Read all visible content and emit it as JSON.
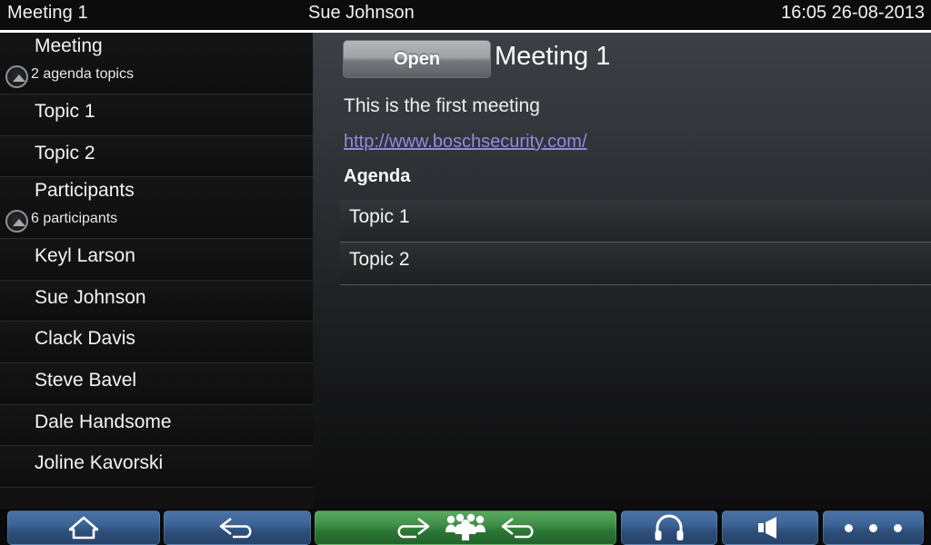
{
  "titlebar": {
    "left": "Meeting 1",
    "center": "Sue Johnson",
    "right": "16:05 26-08-2013"
  },
  "sidebar": {
    "groups": [
      {
        "label": "Meeting",
        "sub": "2 agenda topics",
        "icon": "collapse-up-icon"
      },
      {
        "label": "Topic 1"
      },
      {
        "label": "Topic 2"
      },
      {
        "label": "Participants",
        "sub": "6 participants",
        "icon": "collapse-up-icon"
      },
      {
        "label": "Keyl Larson"
      },
      {
        "label": "Sue Johnson"
      },
      {
        "label": "Clack Davis"
      },
      {
        "label": "Steve Bavel"
      },
      {
        "label": "Dale Handsome"
      },
      {
        "label": "Joline Kavorski"
      }
    ]
  },
  "main": {
    "open_label": "Open",
    "title": "Meeting 1",
    "description": "This is the first meeting",
    "link": "http://www.boschsecurity.com/",
    "agenda_heading": "Agenda",
    "agenda_items": [
      "Topic 1",
      "Topic 2"
    ]
  },
  "toolbar": {
    "buttons": [
      {
        "name": "home-button",
        "icon": "home-icon",
        "color": "#3c6497"
      },
      {
        "name": "back-button",
        "icon": "back-arrow-icon",
        "color": "#3c6497"
      },
      {
        "name": "discussion-button",
        "icon": "forward-arrow-icon / group-of-people-icon / back-arrow-icon",
        "color": "#42914a"
      },
      {
        "name": "headphones-button",
        "icon": "headphones-icon",
        "color": "#3c6497"
      },
      {
        "name": "volume-button",
        "icon": "speaker-icon",
        "color": "#3c6497"
      },
      {
        "name": "more-button",
        "icon": "three-dots-icon",
        "color": "#3c6497"
      }
    ]
  },
  "colors": {
    "accent_blue": "#3c6497",
    "accent_green": "#42914a",
    "link": "#8f8ce0",
    "sidebar_bg": "#121212",
    "panel_bg": "#3c4045"
  }
}
